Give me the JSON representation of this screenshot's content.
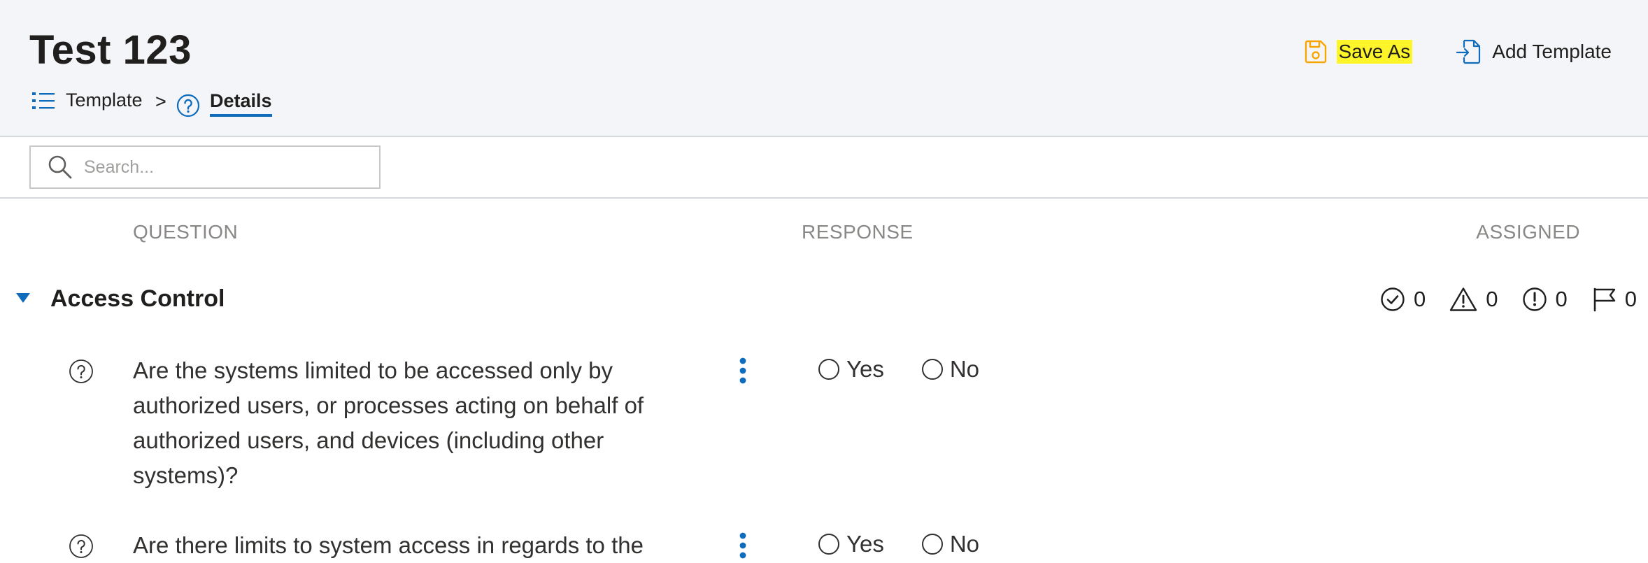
{
  "header": {
    "title": "Test 123",
    "breadcrumb": {
      "template_label": "Template",
      "separator": ">",
      "current_label": "Details"
    },
    "actions": {
      "save_as_label": "Save As",
      "add_template_label": "Add Template"
    }
  },
  "search": {
    "placeholder": "Search...",
    "value": ""
  },
  "columns": {
    "question": "QUESTION",
    "response": "RESPONSE",
    "assigned": "ASSIGNED"
  },
  "section": {
    "title": "Access Control",
    "counters": {
      "completed": "0",
      "warnings": "0",
      "issues": "0",
      "flags": "0"
    }
  },
  "questions": [
    {
      "text": "Are the systems limited to be accessed only by authorized users, or processes acting on behalf of authorized users, and devices (including other systems)?",
      "options": [
        "Yes",
        "No"
      ]
    },
    {
      "text": "Are there limits to system access in regards to the",
      "options": [
        "Yes",
        "No"
      ]
    }
  ],
  "colors": {
    "accent_blue": "#0f6cbd",
    "save_icon_orange": "#f7a600",
    "highlight_yellow": "#fdf42a",
    "header_bg": "#f3f5f8"
  },
  "icons": {
    "template": "list-icon",
    "details": "help-circle-icon",
    "save_as": "save-icon",
    "add_template": "add-document-icon",
    "search": "search-icon",
    "section_toggle": "caret-down-icon",
    "completed": "check-circle-icon",
    "warnings": "warning-triangle-icon",
    "issues": "exclamation-circle-icon",
    "flags": "flag-icon",
    "question_help": "help-circle-icon",
    "question_menu": "more-vertical-icon"
  }
}
